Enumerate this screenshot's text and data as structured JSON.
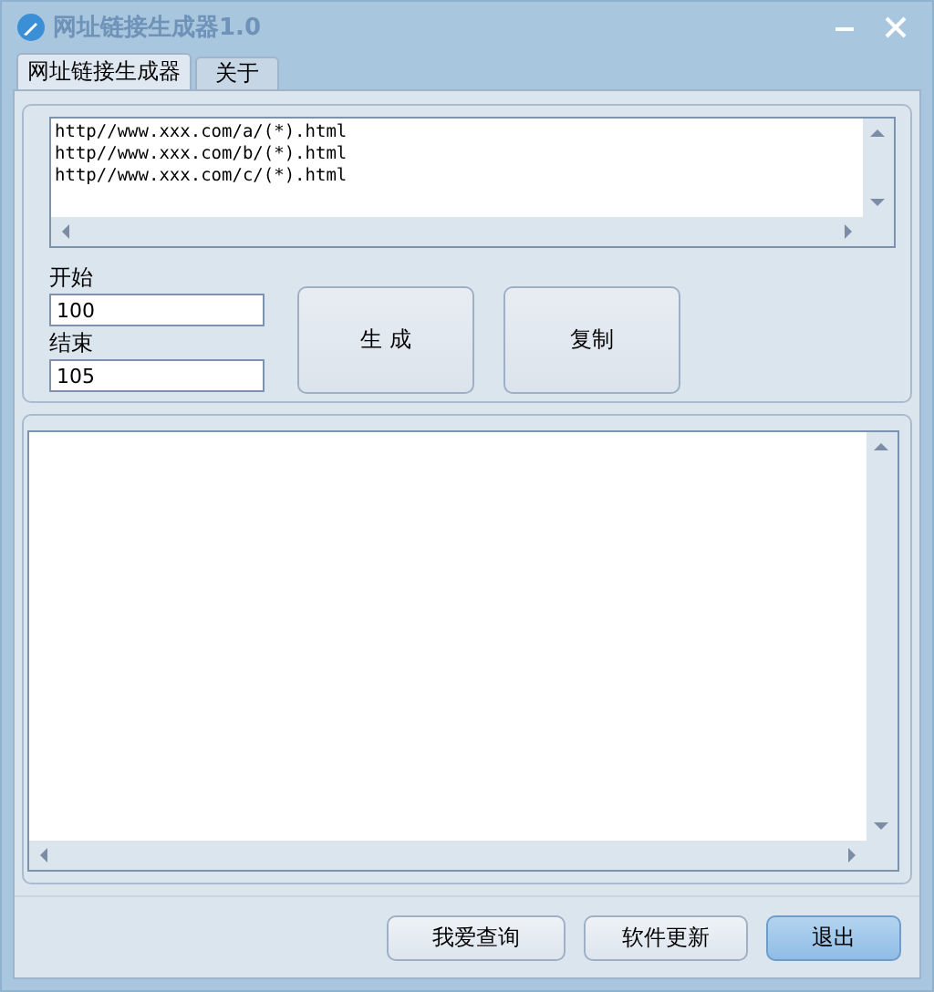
{
  "window": {
    "title": "网址链接生成器1.0"
  },
  "tabs": [
    {
      "label": "网址链接生成器",
      "selected": true
    },
    {
      "label": "关于",
      "selected": false
    }
  ],
  "url_patterns": [
    "http//www.xxx.com/a/(*).html",
    "http//www.xxx.com/b/(*).html",
    "http//www.xxx.com/c/(*).html"
  ],
  "start": {
    "label": "开始",
    "value": "100"
  },
  "end": {
    "label": "结束",
    "value": "105"
  },
  "actions": [
    "生 成",
    "复制"
  ],
  "buttons": [
    {
      "label": "我爱查询",
      "selected": false
    },
    {
      "label": "软件更新",
      "selected": false
    },
    {
      "label": "退出",
      "selected": true
    }
  ]
}
